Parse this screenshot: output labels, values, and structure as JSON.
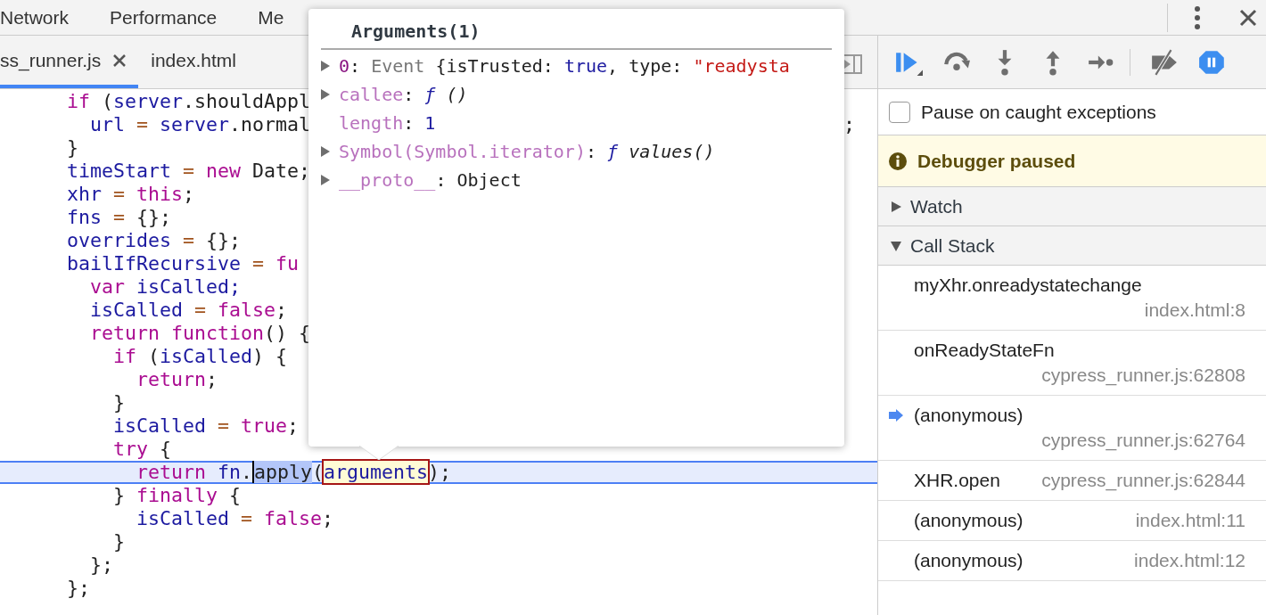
{
  "top_tabs": [
    {
      "label": "Network"
    },
    {
      "label": "Performance"
    },
    {
      "label": "Me"
    }
  ],
  "file_tabs": [
    {
      "label": "ss_runner.js",
      "selected": true,
      "closable": true
    },
    {
      "label": "index.html",
      "selected": false,
      "closable": false
    }
  ],
  "code_lines": [
    {
      "current": false,
      "tokens": [
        {
          "text": "if",
          "kind": "kw"
        },
        {
          "text": " (",
          "kind": "plain"
        },
        {
          "text": "server",
          "kind": "def"
        },
        {
          "text": ".shouldAppl",
          "kind": "plain"
        }
      ]
    },
    {
      "current": false,
      "tail": ";",
      "tokens": [
        {
          "text": "  url",
          "kind": "def"
        },
        {
          "text": " = ",
          "kind": "op"
        },
        {
          "text": "server",
          "kind": "def"
        },
        {
          "text": ".normal",
          "kind": "plain"
        }
      ]
    },
    {
      "current": false,
      "tokens": [
        {
          "text": "}",
          "kind": "plain"
        }
      ]
    },
    {
      "current": false,
      "tokens": [
        {
          "text": "timeStart",
          "kind": "def"
        },
        {
          "text": " = ",
          "kind": "op"
        },
        {
          "text": "new",
          "kind": "kw"
        },
        {
          "text": " Date;",
          "kind": "plain"
        }
      ]
    },
    {
      "current": false,
      "tokens": [
        {
          "text": "xhr",
          "kind": "def"
        },
        {
          "text": " = ",
          "kind": "op"
        },
        {
          "text": "this",
          "kind": "kw"
        },
        {
          "text": ";",
          "kind": "plain"
        }
      ]
    },
    {
      "current": false,
      "tokens": [
        {
          "text": "fns",
          "kind": "def"
        },
        {
          "text": " = ",
          "kind": "op"
        },
        {
          "text": "{};",
          "kind": "plain"
        }
      ]
    },
    {
      "current": false,
      "tokens": [
        {
          "text": "overrides",
          "kind": "def"
        },
        {
          "text": " = ",
          "kind": "op"
        },
        {
          "text": "{};",
          "kind": "plain"
        }
      ]
    },
    {
      "current": false,
      "tokens": [
        {
          "text": "bailIfRecursive",
          "kind": "def"
        },
        {
          "text": " = ",
          "kind": "op"
        },
        {
          "text": "fu",
          "kind": "kw"
        }
      ]
    },
    {
      "current": false,
      "tokens": [
        {
          "text": "  var",
          "kind": "kw"
        },
        {
          "text": " isCalled;",
          "kind": "def"
        }
      ]
    },
    {
      "current": false,
      "tokens": [
        {
          "text": "  isCalled",
          "kind": "def"
        },
        {
          "text": " = ",
          "kind": "op"
        },
        {
          "text": "false",
          "kind": "kw"
        },
        {
          "text": ";",
          "kind": "plain"
        }
      ]
    },
    {
      "current": false,
      "tokens": [
        {
          "text": "  return",
          "kind": "kw"
        },
        {
          "text": " function",
          "kind": "kw"
        },
        {
          "text": "() {",
          "kind": "plain"
        }
      ]
    },
    {
      "current": false,
      "tokens": [
        {
          "text": "    if",
          "kind": "kw"
        },
        {
          "text": " (",
          "kind": "plain"
        },
        {
          "text": "isCalled",
          "kind": "def"
        },
        {
          "text": ") {",
          "kind": "plain"
        }
      ]
    },
    {
      "current": false,
      "tokens": [
        {
          "text": "      return",
          "kind": "kw"
        },
        {
          "text": ";",
          "kind": "plain"
        }
      ]
    },
    {
      "current": false,
      "tokens": [
        {
          "text": "    }",
          "kind": "plain"
        }
      ]
    },
    {
      "current": false,
      "tokens": [
        {
          "text": "    isCalled",
          "kind": "def"
        },
        {
          "text": " = ",
          "kind": "op"
        },
        {
          "text": "true",
          "kind": "kw"
        },
        {
          "text": ";",
          "kind": "plain"
        }
      ]
    },
    {
      "current": false,
      "tokens": [
        {
          "text": "    try",
          "kind": "kw"
        },
        {
          "text": " {",
          "kind": "plain"
        }
      ]
    },
    {
      "current": true,
      "tokens": [
        {
          "text": "      return",
          "kind": "kw"
        },
        {
          "text": " fn",
          "kind": "def"
        },
        {
          "text": ".",
          "kind": "plain"
        },
        {
          "text": "apply",
          "kind": "selection"
        },
        {
          "text": "(",
          "kind": "plain"
        },
        {
          "text": "arguments",
          "kind": "hover"
        },
        {
          "text": ");",
          "kind": "plain"
        }
      ]
    },
    {
      "current": false,
      "tokens": [
        {
          "text": "    } ",
          "kind": "plain"
        },
        {
          "text": "finally",
          "kind": "kw"
        },
        {
          "text": " {",
          "kind": "plain"
        }
      ]
    },
    {
      "current": false,
      "tokens": [
        {
          "text": "      isCalled",
          "kind": "def"
        },
        {
          "text": " = ",
          "kind": "op"
        },
        {
          "text": "false",
          "kind": "kw"
        },
        {
          "text": ";",
          "kind": "plain"
        }
      ]
    },
    {
      "current": false,
      "tokens": [
        {
          "text": "    }",
          "kind": "plain"
        }
      ]
    },
    {
      "current": false,
      "tokens": [
        {
          "text": "  };",
          "kind": "plain"
        }
      ]
    },
    {
      "current": false,
      "tokens": [
        {
          "text": "};",
          "kind": "plain"
        }
      ]
    }
  ],
  "popover": {
    "title": "Arguments(1)",
    "entries": [
      {
        "expandable": true,
        "tokens": [
          {
            "text": "0",
            "kind": "index"
          },
          {
            "text": ": ",
            "kind": "plain"
          },
          {
            "text": "Event",
            "kind": "gray"
          },
          {
            "text": " {isTrusted: ",
            "kind": "plain"
          },
          {
            "text": "true",
            "kind": "number"
          },
          {
            "text": ", type: ",
            "kind": "plain"
          },
          {
            "text": "\"readysta",
            "kind": "string"
          }
        ]
      },
      {
        "expandable": true,
        "tokens": [
          {
            "text": "callee",
            "kind": "prop"
          },
          {
            "text": ": ",
            "kind": "plain"
          },
          {
            "text": "ƒ",
            "kind": "fn"
          },
          {
            "text": " ()",
            "kind": "italic"
          }
        ]
      },
      {
        "expandable": false,
        "tokens": [
          {
            "text": "length",
            "kind": "prop"
          },
          {
            "text": ": ",
            "kind": "plain"
          },
          {
            "text": "1",
            "kind": "number"
          }
        ]
      },
      {
        "expandable": true,
        "tokens": [
          {
            "text": "Symbol(Symbol.iterator)",
            "kind": "prop"
          },
          {
            "text": ": ",
            "kind": "plain"
          },
          {
            "text": "ƒ",
            "kind": "fn"
          },
          {
            "text": " values()",
            "kind": "italic"
          }
        ]
      },
      {
        "expandable": true,
        "tokens": [
          {
            "text": "__proto__",
            "kind": "prop"
          },
          {
            "text": ": ",
            "kind": "plain"
          },
          {
            "text": "Object",
            "kind": "plain"
          }
        ]
      }
    ]
  },
  "debug_toolbar": [
    {
      "kind": "resume",
      "active": true
    },
    {
      "kind": "step-over",
      "active": false
    },
    {
      "kind": "step-into",
      "active": false
    },
    {
      "kind": "step-out",
      "active": false
    },
    {
      "kind": "step",
      "active": false
    },
    {
      "kind": "deactivate",
      "active": false
    },
    {
      "kind": "pause-exceptions",
      "active": true
    }
  ],
  "pause_on_caught": {
    "label": "Pause on caught exceptions",
    "checked": false
  },
  "banner": "Debugger paused",
  "sections": [
    {
      "title": "Watch",
      "expanded": false
    },
    {
      "title": "Call Stack",
      "expanded": true
    }
  ],
  "call_stack": [
    {
      "name": "myXhr.onreadystatechange",
      "location": "index.html:8",
      "current": false
    },
    {
      "name": "onReadyStateFn",
      "location": "cypress_runner.js:62808",
      "current": false
    },
    {
      "name": "(anonymous)",
      "location": "cypress_runner.js:62764",
      "current": true
    },
    {
      "name": "XHR.open",
      "location": "cypress_runner.js:62844",
      "current": false
    },
    {
      "name": "(anonymous)",
      "location": "index.html:11",
      "current": false
    },
    {
      "name": "(anonymous)",
      "location": "index.html:12",
      "current": false
    }
  ]
}
